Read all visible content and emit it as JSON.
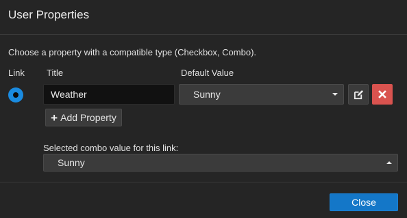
{
  "dialog": {
    "title": "User Properties",
    "instructions": "Choose a property with a compatible type (Checkbox, Combo).",
    "columns": {
      "link": "Link",
      "title": "Title",
      "default_value": "Default Value"
    },
    "property": {
      "link_selected": true,
      "title_value": "Weather",
      "default_value": "Sunny"
    },
    "add_property_label": "Add Property",
    "combo_label": "Selected combo value for this link:",
    "combo_value": "Sunny",
    "close_label": "Close"
  },
  "colors": {
    "accent": "#1a8be0",
    "danger": "#d9534f",
    "primary_button": "#1477c8",
    "background": "#252525"
  },
  "icons": {
    "edit": "edit-icon",
    "delete": "close-icon",
    "add": "plus-icon"
  }
}
